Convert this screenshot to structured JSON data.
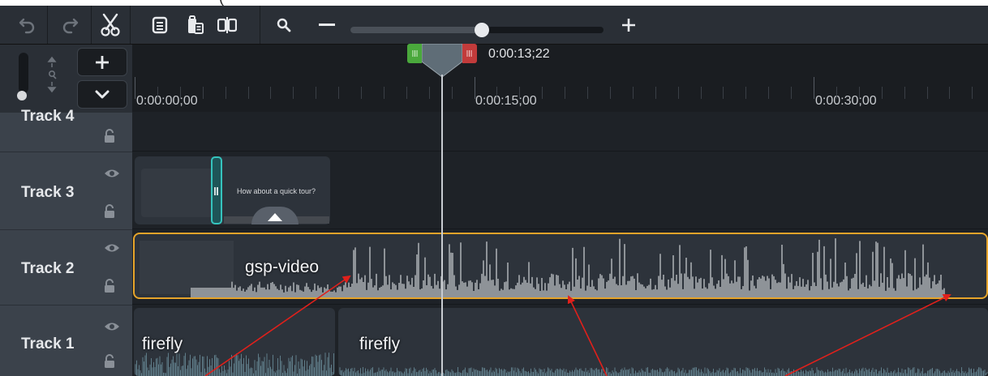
{
  "caption": {
    "text": "( "
  },
  "toolbar": {
    "icons": [
      "undo-icon",
      "redo-icon",
      "cut-icon",
      "copy-icon",
      "paste-icon",
      "split-icon",
      "zoom-search-icon",
      "zoom-out-icon",
      "zoom-in-icon"
    ],
    "zoom_level": 0.52
  },
  "header": {
    "add_label": "+",
    "collapse_label": "⌄",
    "volume_level": 0.05
  },
  "ruler": {
    "labels": [
      "0:00:00;00",
      "0:00:15;00",
      "0:00:30;00"
    ]
  },
  "playhead": {
    "time": "0:00:13;22"
  },
  "tracks": [
    {
      "name": "Track 4"
    },
    {
      "name": "Track 3"
    },
    {
      "name": "Track 2"
    },
    {
      "name": "Track 1"
    }
  ],
  "clips": {
    "track3": {
      "caption": "How about a quick tour?"
    },
    "track2": {
      "label": "gsp-video"
    },
    "track1": [
      {
        "label": "firefly"
      },
      {
        "label": "firefly"
      }
    ]
  },
  "colors": {
    "selection": "#e6a42a",
    "playhead_in": "#4aa83c",
    "playhead_out": "#c23b3b",
    "arrow": "#e0201b",
    "callout_handle": "#35c3bd"
  }
}
